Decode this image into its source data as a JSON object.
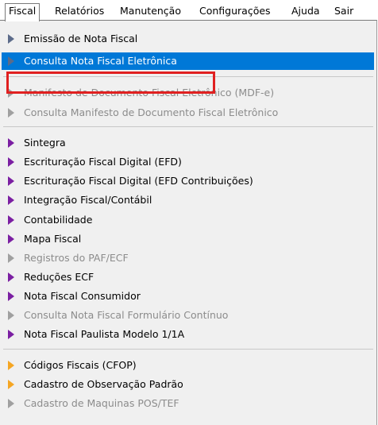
{
  "menubar": {
    "items": [
      "Fiscal",
      "Relatórios",
      "Manutenção",
      "Configurações",
      "Ajuda",
      "Sair"
    ]
  },
  "dropdown": {
    "items": [
      {
        "label": "Emissão de Nota Fiscal",
        "state": "enabled",
        "arrow": "blue-gray"
      },
      {
        "label": "Consulta Nota Fiscal Eletrônica",
        "state": "highlighted",
        "arrow": "blue-gray"
      },
      {
        "label": "Manifesto de Documento Fiscal Eletrônico (MDF-e)",
        "state": "disabled",
        "arrow": "gray"
      },
      {
        "label": "Consulta Manifesto de Documento Fiscal Eletrônico",
        "state": "disabled",
        "arrow": "gray"
      },
      {
        "label": "Sintegra",
        "state": "enabled",
        "arrow": "purple"
      },
      {
        "label": "Escrituração Fiscal Digital (EFD)",
        "state": "enabled",
        "arrow": "purple"
      },
      {
        "label": "Escrituração Fiscal Digital (EFD Contribuições)",
        "state": "enabled",
        "arrow": "purple"
      },
      {
        "label": "Integração Fiscal/Contábil",
        "state": "enabled",
        "arrow": "purple"
      },
      {
        "label": "Contabilidade",
        "state": "enabled",
        "arrow": "purple"
      },
      {
        "label": "Mapa Fiscal",
        "state": "enabled",
        "arrow": "purple"
      },
      {
        "label": "Registros do PAF/ECF",
        "state": "disabled",
        "arrow": "gray"
      },
      {
        "label": "Reduções ECF",
        "state": "enabled",
        "arrow": "purple"
      },
      {
        "label": "Nota Fiscal Consumidor",
        "state": "enabled",
        "arrow": "purple"
      },
      {
        "label": "Consulta Nota Fiscal Formulário Contínuo",
        "state": "disabled",
        "arrow": "gray"
      },
      {
        "label": "Nota Fiscal Paulista Modelo 1/1A",
        "state": "enabled",
        "arrow": "purple"
      },
      {
        "label": "Códigos Fiscais (CFOP)",
        "state": "enabled",
        "arrow": "orange"
      },
      {
        "label": "Cadastro de Observação Padrão",
        "state": "enabled",
        "arrow": "orange"
      },
      {
        "label": "Cadastro de Maquinas POS/TEF",
        "state": "disabled",
        "arrow": "gray"
      }
    ]
  }
}
